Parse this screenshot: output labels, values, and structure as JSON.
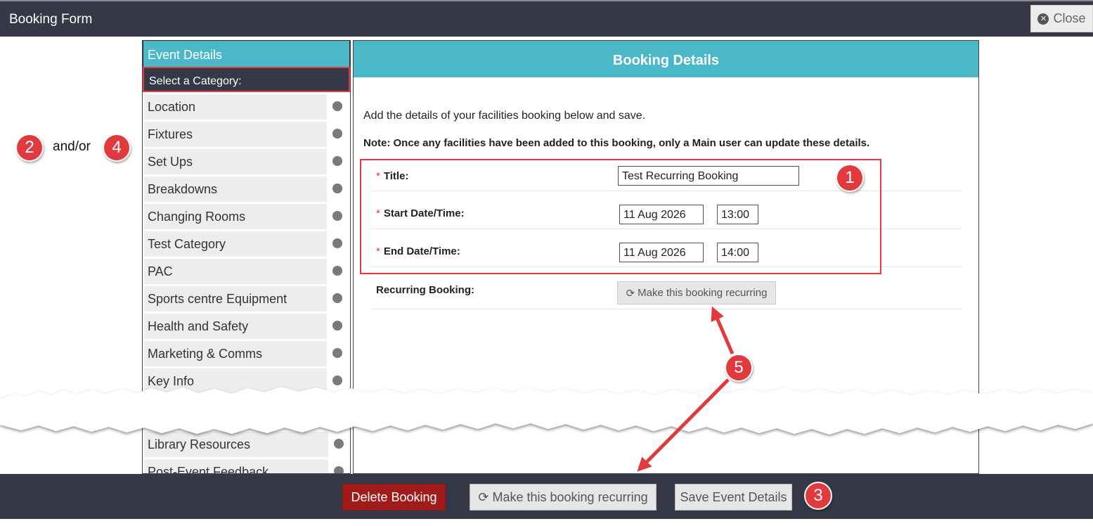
{
  "window": {
    "title": "Booking Form",
    "close_label": "Close"
  },
  "sidebar": {
    "header": "Event Details",
    "category_header": "Select a Category:",
    "items": [
      "Location",
      "Fixtures",
      "Set Ups",
      "Breakdowns",
      "Changing Rooms",
      "Test Category",
      "PAC",
      "Sports centre Equipment",
      "Health and Safety",
      "Marketing & Comms",
      "Key Info"
    ],
    "items_after_cut": [
      "Library Resources",
      "Post-Event Feedback"
    ]
  },
  "main": {
    "header": "Booking Details",
    "intro": "Add the details of your facilities booking below and save.",
    "note": "Note: Once any facilities have been added to this booking, only a Main user can update these details.",
    "title_label": "Title:",
    "title_value": "Test Recurring Booking",
    "start_label": "Start Date/Time:",
    "start_date": "11 Aug 2026",
    "start_time": "13:00",
    "end_label": "End Date/Time:",
    "end_date": "11 Aug 2026",
    "end_time": "14:00",
    "recurring_label": "Recurring Booking:",
    "recurring_button": "Make this booking recurring",
    "required_marker": "*"
  },
  "footer": {
    "delete_label": "Delete Booking",
    "recurring_label": "Make this booking recurring",
    "save_label": "Save Event Details"
  },
  "annotations": {
    "badge_1": "1",
    "badge_2": "2",
    "badge_3": "3",
    "badge_4": "4",
    "badge_5": "5",
    "andor": "and/or"
  },
  "colors": {
    "header_bar": "#363847",
    "accent_teal": "#4bb8c8",
    "highlight_red": "#e03a3e",
    "delete_red": "#a11b1b"
  }
}
